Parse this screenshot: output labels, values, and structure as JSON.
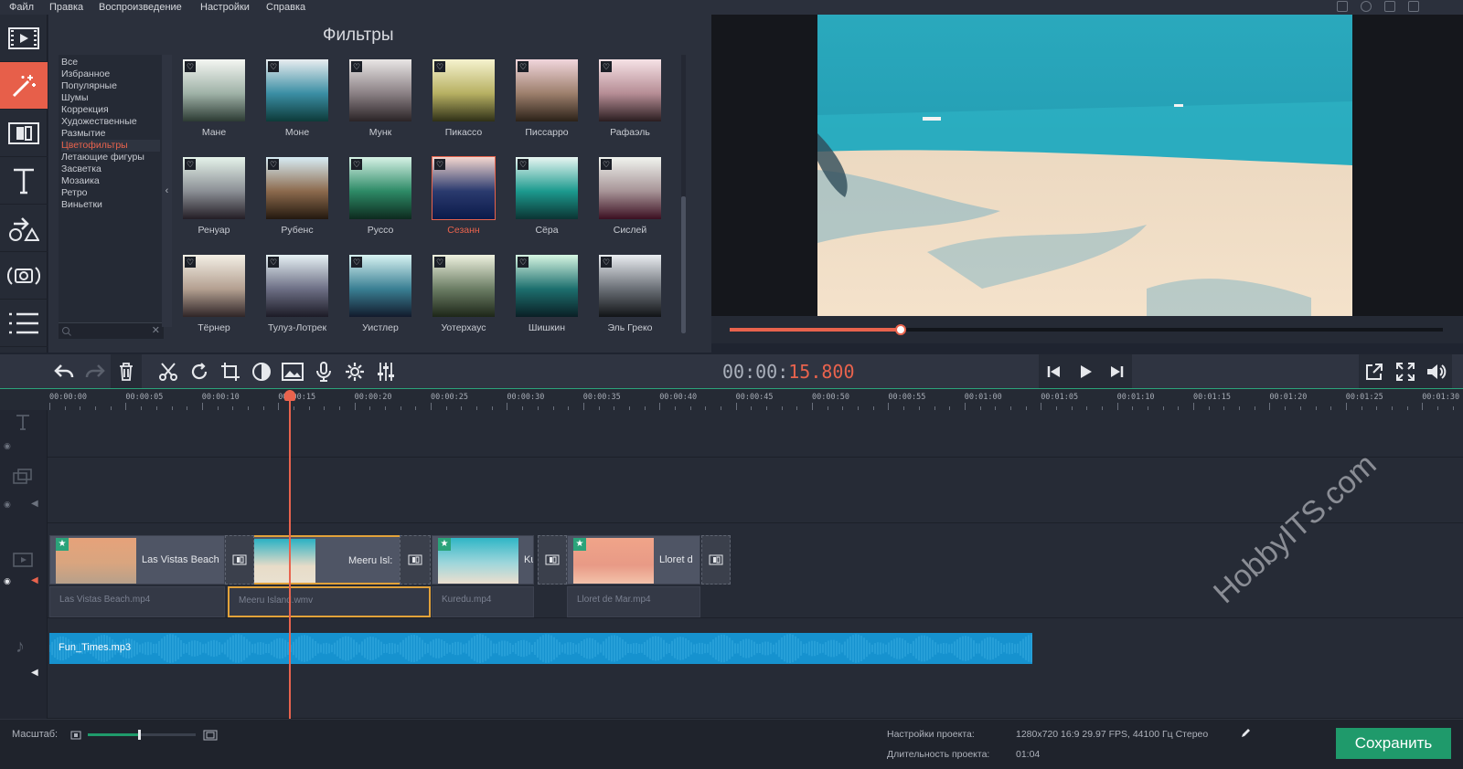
{
  "menu": [
    "Файл",
    "Правка",
    "Воспроизведение",
    "Настройки",
    "Справка"
  ],
  "filters": {
    "title": "Фильтры",
    "categories": [
      "Все",
      "Избранное",
      "Популярные",
      "Шумы",
      "Коррекция",
      "Художественные",
      "Размытие",
      "Цветофильтры",
      "Летающие фигуры",
      "Засветка",
      "Мозаика",
      "Ретро",
      "Виньетки"
    ],
    "selected_category": "Цветофильтры",
    "collapse_glyph": "‹",
    "heart_glyph": "♡",
    "items": [
      {
        "label": "Мане",
        "top": "#f4f6f2",
        "mid": "#9fb2a7",
        "bottom": "#2c3a33"
      },
      {
        "label": "Моне",
        "top": "#e9edf0",
        "mid": "#3b8ea4",
        "bottom": "#0d3a39"
      },
      {
        "label": "Мунк",
        "top": "#e9e6e5",
        "mid": "#8a8084",
        "bottom": "#2a2326"
      },
      {
        "label": "Пикассо",
        "top": "#f6f3cf",
        "mid": "#b7b062",
        "bottom": "#2f3017"
      },
      {
        "label": "Писсарро",
        "top": "#f1d6dc",
        "mid": "#9d7f6c",
        "bottom": "#2b2118"
      },
      {
        "label": "Рафаэль",
        "top": "#f6e2e6",
        "mid": "#b68d95",
        "bottom": "#2a1d20"
      },
      {
        "label": "Ренуар",
        "top": "#e5f3ea",
        "mid": "#8b8f95",
        "bottom": "#231d25"
      },
      {
        "label": "Рубенс",
        "top": "#d7ecf5",
        "mid": "#8c6a4d",
        "bottom": "#23180f"
      },
      {
        "label": "Руссо",
        "top": "#d7f2e6",
        "mid": "#2d8a66",
        "bottom": "#0d2a1e"
      },
      {
        "label": "Сезанн",
        "top": "#f4d7cf",
        "mid": "#2a3a6e",
        "bottom": "#0b1a4a"
      },
      {
        "label": "Сёра",
        "top": "#e9f6f2",
        "mid": "#1c9a8e",
        "bottom": "#0b3433"
      },
      {
        "label": "Сислей",
        "top": "#f1f4ef",
        "mid": "#a79497",
        "bottom": "#3b0f21"
      },
      {
        "label": "Тёрнер",
        "top": "#f3efe5",
        "mid": "#b4a091",
        "bottom": "#2f2527"
      },
      {
        "label": "Тулуз-Лотрек",
        "top": "#e6f1f4",
        "mid": "#6d6f85",
        "bottom": "#1c1b26"
      },
      {
        "label": "Уистлер",
        "top": "#d8f3f2",
        "mid": "#3a7f93",
        "bottom": "#121a2c"
      },
      {
        "label": "Уотерхаус",
        "top": "#eef1df",
        "mid": "#6b7d64",
        "bottom": "#1d2618"
      },
      {
        "label": "Шишкин",
        "top": "#d7f6e2",
        "mid": "#1d6f6e",
        "bottom": "#0a1f25"
      },
      {
        "label": "Эль Греко",
        "top": "#eaedf1",
        "mid": "#6a6f76",
        "bottom": "#111316"
      }
    ],
    "selected_item": "Сезанн"
  },
  "playback": {
    "timecode_prefix": "00:00:",
    "timecode_value": "15.800",
    "progress": 0.24
  },
  "ruler": [
    "00:00:00",
    "00:00:05",
    "00:00:10",
    "00:00:15",
    "00:00:20",
    "00:00:25",
    "00:00:30",
    "00:00:35",
    "00:00:40",
    "00:00:45",
    "00:00:50",
    "00:00:55",
    "00:01:00",
    "00:01:05",
    "00:01:10",
    "00:01:15",
    "00:01:20",
    "00:01:25",
    "00:01:30"
  ],
  "clips": [
    {
      "title": "Las Vistas Beach",
      "audio": "Las Vistas Beach.mp4",
      "selected": false
    },
    {
      "title": "Meeru Isl:",
      "audio": "Meeru Island.wmv",
      "selected": true
    },
    {
      "title": "Ku",
      "audio": "Kuredu.mp4",
      "selected": false
    },
    {
      "title": "Lloret d",
      "audio": "Lloret de Mar.mp4",
      "selected": false
    }
  ],
  "music": {
    "title": "Fun_Times.mp3"
  },
  "watermark": "HobbyITS.com",
  "status": {
    "zoom_label": "Масштаб:",
    "zoom_value": 0.47,
    "settings_label": "Настройки проекта:",
    "settings_value": "1280x720 16:9 29.97 FPS, 44100 Гц Стерео",
    "duration_label": "Длительность проекта:",
    "duration_value": "01:04",
    "save_label": "Сохранить"
  },
  "colors": {
    "accent": "#e9634d",
    "save": "#1f9a6b",
    "music_track": "#1692cf",
    "selection": "#e2a23a"
  }
}
